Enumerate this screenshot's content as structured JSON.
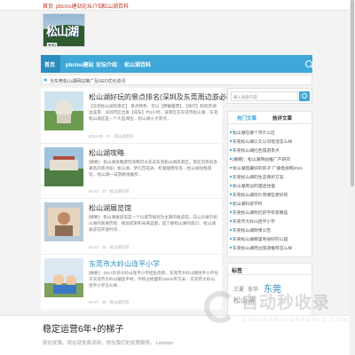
{
  "topbar": {
    "links": [
      "首页",
      "pbcms建站",
      "论坛介绍",
      "松山湖百科"
    ]
  },
  "logo": {
    "text": "松山湖网"
  },
  "nav": {
    "items": [
      "首页",
      "pbcms建站",
      "论坛介绍",
      "松山湖百科"
    ]
  },
  "notice": {
    "text": "当东莞松山湖网站推广及SEO优化资讯"
  },
  "articles": [
    {
      "title": "松山湖好玩的景点排名(深圳及东莞周边游必看)",
      "excerpt": "【东莞松山湖风景区】 景点特色：可以【野餐露营】、【骑行】和欣赏湖边美景，深圳市区出发【驾车】约1小时，该景区在东莞市松山湖... 东莞松山湖这是一个大型湖边... 松山湖十大景点...",
      "date": "2023-09",
      "views": "27",
      "category": "松山湖百科"
    },
    {
      "title": "松山湖攻略",
      "excerpt": "[摘要]：松山湖攻略游玩攻略可以先去东莞松山湖风景区，景区内有很多著名的景点如：松山湖、梦幻百花洲、松湖烟雨等等... 松山湖攻略游玩... 松山湖一日游路线推荐...",
      "date": "04-27",
      "views": "27",
      "category": "松山湖百科"
    },
    {
      "title": "松山湖展览馆",
      "excerpt": "[摘要]：松山湖展览馆是一个以城市规划为主题的展览馆，向公众展示松山湖的发展历程、规划成果和未来蓝图，是了解松山湖的窗口... 松山湖展览馆开放时间...",
      "date": "04-27",
      "views": "26",
      "category": "松山湖百科"
    },
    {
      "title": "东莞市大岭山连平小学",
      "excerpt": "[摘要]：2017东莞大岭山连平小学招生简章，东莞市大岭山镇连平小学位于东莞市大岭山镇连平村，学校占地面积19000平方米... 东莞市大岭山连平小学怎么样...",
      "date": "04-27",
      "views": "26",
      "category": "松山湖百科"
    }
  ],
  "sidebar": {
    "search_placeholder": "输入搜索内容",
    "tabs": [
      "热门文章",
      "热评文章"
    ],
    "list": [
      "松山湖在哪个市什么区",
      "东莞松山湖公交公司电话怎么样",
      "东莞松山湖红色旅游景点",
      "[摘要]：松山湖网站推广产研究",
      "松山湖塔最好的房子 广播电视网2021",
      "东莞松山湖的生态保护方案",
      "松山湖周边的酒店住宿",
      "东莞松山湖房价有哪些更好的",
      "松山湖科技学校",
      "东莞松山湖附近的学校有哪些",
      "东莞市大岭山连平小学",
      "东莞松山湖政策公告",
      "东莞松山湖哪里有很好的公园",
      "东莞松山湖周边旅游推荐怎么样"
    ],
    "tags_title": "标签",
    "tags": [
      "东莞",
      "三夏",
      "东华",
      "松山湖"
    ]
  },
  "banner": {
    "title": "稳定运营6年+的梯子",
    "subtitle": "别在犹豫，现在就免费试用，体验我们的优质服务。 Letsvpn"
  },
  "watermark": {
    "text": "自动秒收录",
    "sub": "ZIDONGMIAOSHOULU.COM"
  }
}
